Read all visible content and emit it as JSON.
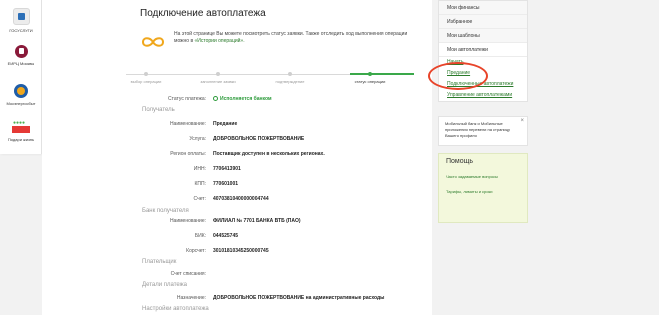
{
  "shortcuts": [
    {
      "label": "ГОСУСЛУГИ",
      "icon": "gosuslugi-icon"
    },
    {
      "label": "ЕИРЦ Москвы",
      "icon": "eirc-icon"
    },
    {
      "label": "Мосэнергосбыт",
      "icon": "mosenergosbyt-icon"
    },
    {
      "label": "Подари жизнь",
      "icon": "podari-zhizn-icon"
    }
  ],
  "page": {
    "title": "Подключение автоплатежа",
    "intro": "На этой странице Вы можете посмотреть статус заявки. Также отследить ход выполнения операции можно в ",
    "intro_link": "«Истории операций».",
    "steps": [
      "выбор операции",
      "заполнение заявки",
      "подтверждение",
      "статус операции"
    ]
  },
  "form": {
    "status_label": "Статус платежа:",
    "status_value": "Исполняется банком",
    "section_recipient": "Получатель",
    "name_label": "Наименование:",
    "name_value": "Предание",
    "service_label": "Услуга:",
    "service_value": "ДОБРОВОЛЬНОЕ ПОЖЕРТВОВАНИЕ",
    "region_label": "Регион оплаты:",
    "region_value": "Поставщик доступен в нескольких регионах.",
    "inn_label": "ИНН:",
    "inn_value": "7706413901",
    "kpp_label": "КПП:",
    "kpp_value": "770601001",
    "account_label": "Счет:",
    "account_value": "40703810400000004744",
    "section_bank": "Банк получателя",
    "bank_name_label": "Наименование:",
    "bank_name_value": "ФИЛИАЛ № 7701 БАНКА ВТБ (ПАО)",
    "bik_label": "БИК:",
    "bik_value": "044525745",
    "corr_label": "Корсчет:",
    "corr_value": "30101810345250000745",
    "section_payer": "Плательщик",
    "debit_label": "Счет списания:",
    "section_details": "Детали платежа",
    "purpose_label": "Назначение:",
    "purpose_value": "ДОБРОВОЛЬНОЕ ПОЖЕРТВОВАНИЕ на административные расходы",
    "section_settings": "Настройки автоплатежа"
  },
  "sidebar": {
    "items": [
      "Мои финансы",
      "Избранное",
      "Мои шаблоны",
      "Мои автоплатежи"
    ],
    "sub": [
      "Начать",
      "Предание",
      "Подключенные автоплатежи",
      "Управление автоплатежами"
    ]
  },
  "promo": {
    "text": "Мобильный банк и Мобильные приложения перевели на страницу Вашего профиля",
    "close": "×"
  },
  "help": {
    "title": "Помощь",
    "links": [
      "Часто задаваемые вопросы",
      "Тарифы, лимиты и сроки"
    ]
  },
  "colors": {
    "accent_green": "#3aa84a",
    "highlight_oval": "#e8442a",
    "link_green": "#2a7a2a",
    "infinity_orange": "#f0a71c"
  }
}
